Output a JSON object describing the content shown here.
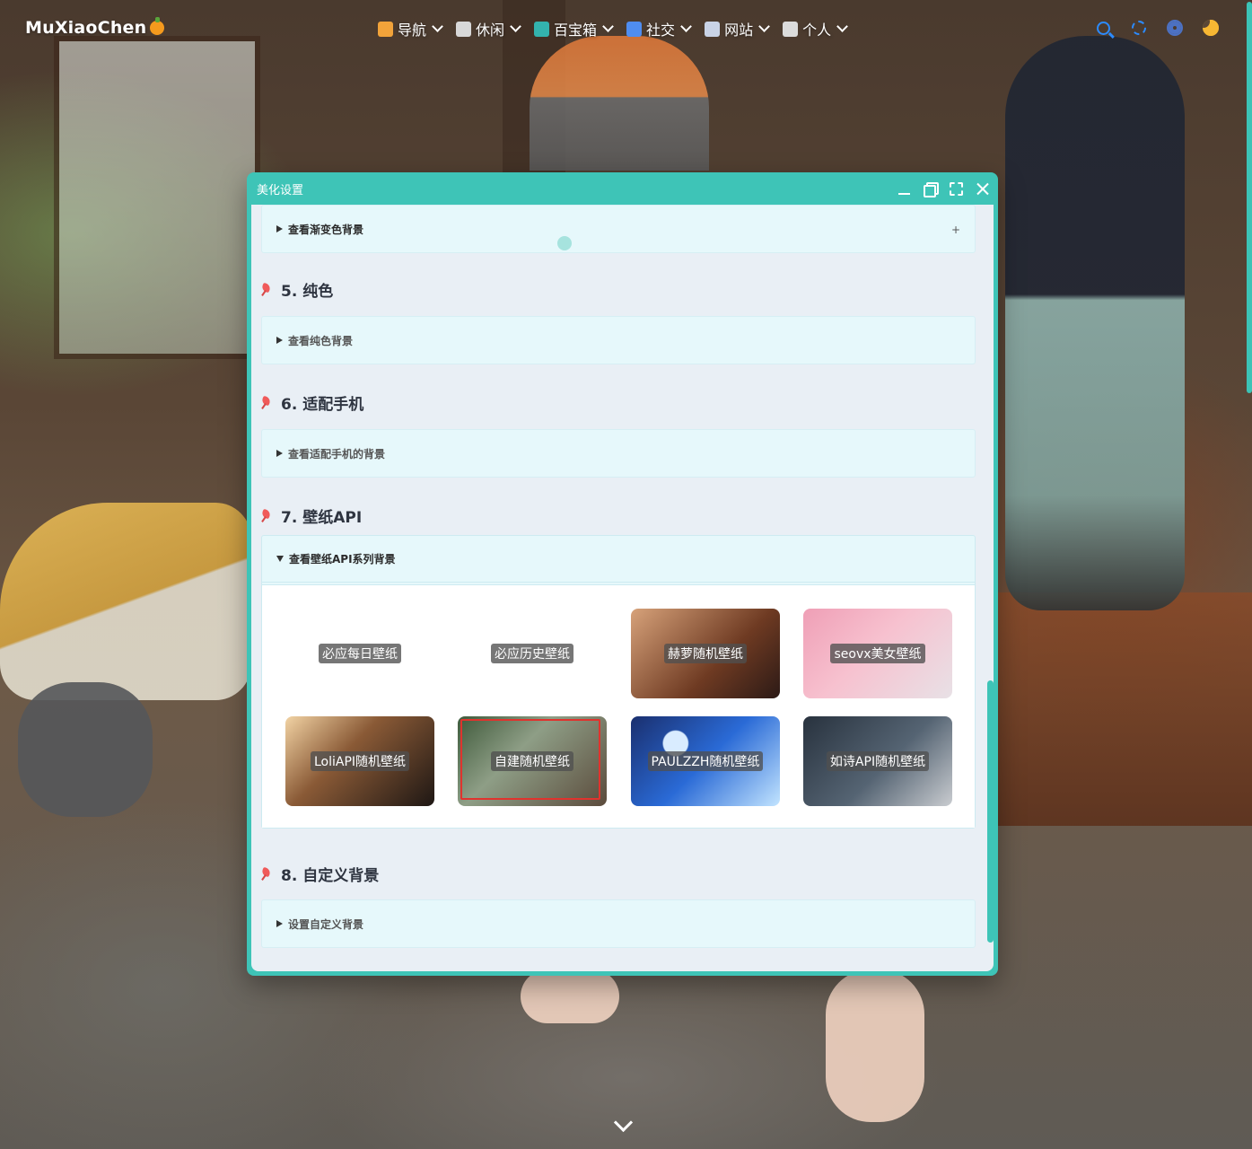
{
  "brand": {
    "name": "MuXiaoChen"
  },
  "nav": {
    "items": [
      {
        "label": "导航",
        "icon": "compass-box-icon",
        "color": "#f2a33a"
      },
      {
        "label": "休闲",
        "icon": "coffee-icon",
        "color": "#d8d8d8"
      },
      {
        "label": "百宝箱",
        "icon": "gift-icon",
        "color": "#33b3ae"
      },
      {
        "label": "社交",
        "icon": "chat-icon",
        "color": "#4f8df0"
      },
      {
        "label": "网站",
        "icon": "id-card-icon",
        "color": "#c9d3e6"
      },
      {
        "label": "个人",
        "icon": "clipboard-icon",
        "color": "#dcdcdc"
      }
    ],
    "tools": {
      "search": "search-icon",
      "settings": "settings-icon",
      "fingerprint": "fingerprint-icon",
      "theme": "moon-icon"
    }
  },
  "dialog": {
    "title": "美化设置",
    "gradient_summary": "查看渐变色背景",
    "gradient_toggle": "+",
    "sections": [
      {
        "number": "5.",
        "title": "纯色",
        "summary": "查看纯色背景"
      },
      {
        "number": "6.",
        "title": "适配手机",
        "summary": "查看适配手机的背景"
      },
      {
        "number": "7.",
        "title": "壁纸API",
        "summary": "查看壁纸API系列背景"
      },
      {
        "number": "8.",
        "title": "自定义背景",
        "summary": "设置自定义背景"
      }
    ],
    "wallpapers": [
      {
        "label": "必应每日壁纸"
      },
      {
        "label": "必应历史壁纸"
      },
      {
        "label": "赫萝随机壁纸"
      },
      {
        "label": "seovx美女壁纸"
      },
      {
        "label": "LoliAPI随机壁纸"
      },
      {
        "label": "自建随机壁纸",
        "selected": true
      },
      {
        "label": "PAULZZH随机壁纸"
      },
      {
        "label": "如诗API随机壁纸"
      }
    ]
  },
  "colors": {
    "accent": "#3ec4b7",
    "panel": "#e6f8fb",
    "heading": "#2e3440"
  }
}
